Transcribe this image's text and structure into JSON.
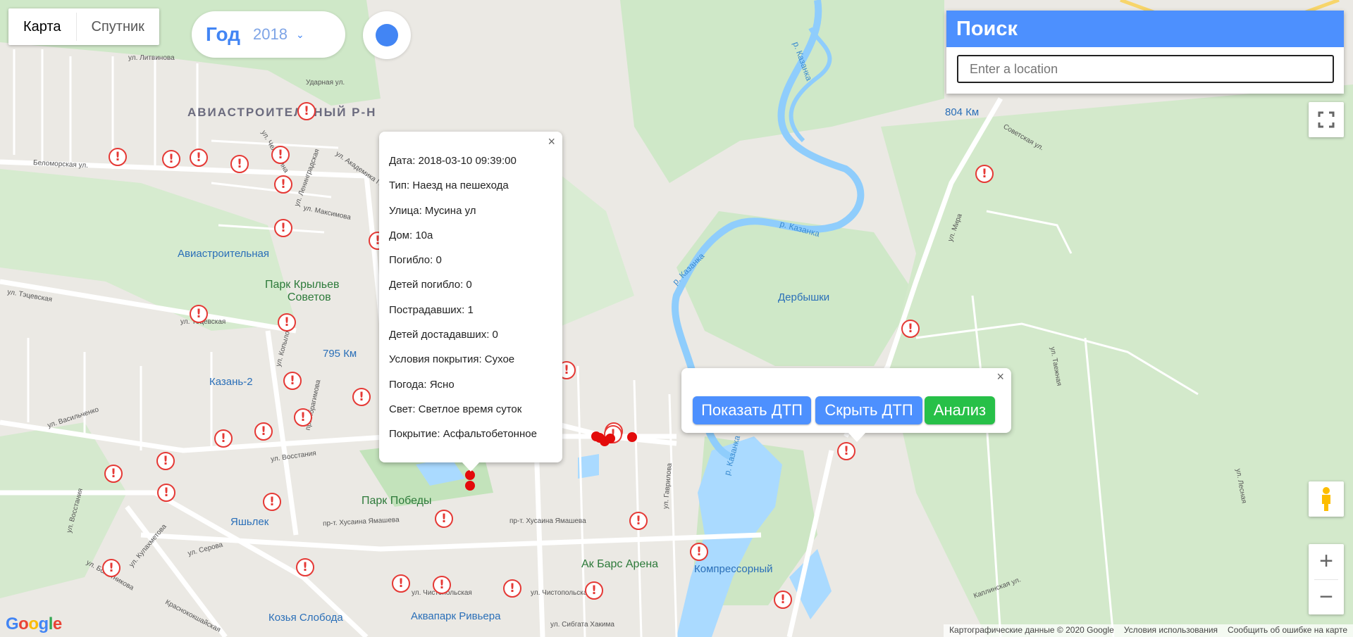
{
  "map_type": {
    "map_label": "Карта",
    "satellite_label": "Спутник",
    "active": "map"
  },
  "year_selector": {
    "label": "Год",
    "value": "2018"
  },
  "search": {
    "title": "Поиск",
    "placeholder": "Enter a location",
    "value": ""
  },
  "info_window": {
    "rows": [
      "Дата: 2018-03-10 09:39:00",
      "Тип: Наезд на пешехода",
      "Улица: Мусина ул",
      "Дом: 10а",
      "Погибло: 0",
      "Детей погибло: 0",
      "Пострадавших: 1",
      "Детей достадавших: 0",
      "Условия покрытия: Сухое",
      "Погода: Ясно",
      "Свет: Светлое время суток",
      "Покрытие: Асфальтобетонное"
    ],
    "close_glyph": "×"
  },
  "actions_panel": {
    "close_glyph": "×",
    "show_label": "Показать ДТП",
    "hide_label": "Скрыть ДТП",
    "analysis_label": "Анализ"
  },
  "map_labels": {
    "district": "АВИАСТРОИТЕЛЬНЫЙ Р-Н",
    "aviastroitelnaya": "Авиастроительная",
    "park_kryl_1": "Парк Крыльев",
    "park_kryl_2": "Советов",
    "km795": "795 Км",
    "kazan2": "Казань-2",
    "yashlek": "Яшьлек",
    "park_pobedy": "Парк Победы",
    "ak_bars": "Ак Барс Арена",
    "kompressorny": "Компрессорный",
    "kozya_sloboda": "Козья Слобода",
    "akvapark": "Аквапарк Ривьера",
    "derbyshki": "Дербышки",
    "km804": "804 Км",
    "kazanka": "р. Казанка",
    "st_belomorskaya": "Беломорская ул.",
    "st_litvinova": "ул. Литвинова",
    "st_udarnaya": "Ударная ул.",
    "st_chelyuskina": "ул. Челюскина",
    "st_akademika": "ул. Академика П.",
    "st_leningradskaya": "ул. Ленинградская",
    "st_maksimova": "ул. Максимова",
    "st_tatsevskaya": "ул. Тэцевская",
    "st_vasilchenko": "ул. Васильченко",
    "st_vosstaniya": "ул. Восстания",
    "st_kopylova": "ул. Копылова",
    "st_ibragimova": "пр. Ибрагимова",
    "st_yamasheva": "пр-т. Хусаина Ямашева",
    "st_chistopolskaya": "ул. Чистопольская",
    "st_sibgata": "ул. Сибгата Хакима",
    "st_gavrilova": "ул. Гаврилова",
    "st_serova": "ул. Серова",
    "st_kulakhmetova": "ул. Кулахметова",
    "st_bolotnikova": "ул. Болотникова",
    "st_krasnokokshaiskaya": "Краснококшайская",
    "st_sovetskaya": "Советская ул.",
    "st_mira": "ул. Мира",
    "st_taezhnaya": "ул. Таежная",
    "st_lesnaya": "ул. Лесная",
    "st_kaplinskaya": "Каплинская ул."
  },
  "attribution": {
    "data": "Картографические данные © 2020 Google",
    "terms": "Условия использования",
    "report": "Сообщить об ошибке на карте"
  },
  "google_logo": "Google",
  "icons": {
    "fullscreen": "fullscreen-icon",
    "pegman": "pegman-icon",
    "zoom_in": "+",
    "zoom_out": "−",
    "marker": "!"
  },
  "colors": {
    "accent": "#4d90fe",
    "green": "#27c048",
    "marker": "#e53935"
  }
}
